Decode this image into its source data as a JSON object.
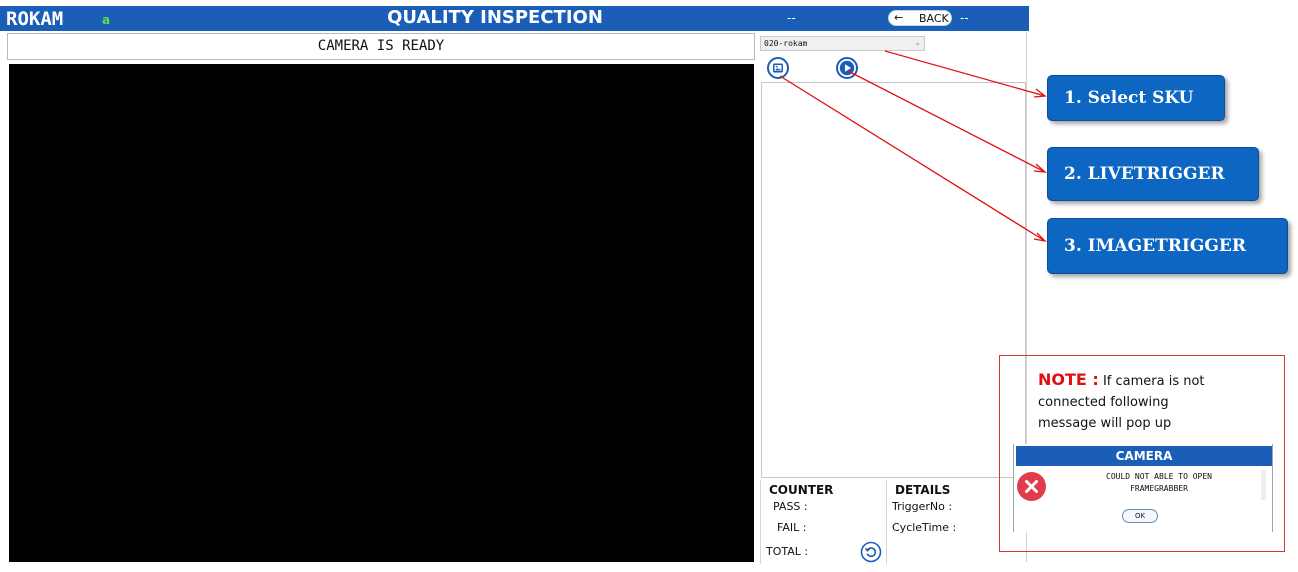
{
  "header": {
    "brand": "ROKAM",
    "brand_sub": "a",
    "title": "QUALITY INSPECTION",
    "status_left": "--",
    "back_label": "BACK",
    "back_icon": "arrow-left-icon",
    "status_right": "--"
  },
  "status_message": "CAMERA IS READY",
  "sku_select": {
    "value": "020-rokam",
    "icon": "chevron-down-icon"
  },
  "trigger_buttons": {
    "image_icon": "image-icon",
    "live_icon": "play-icon"
  },
  "counter": {
    "title": "COUNTER",
    "pass_label": "PASS :",
    "fail_label": "FAIL :",
    "total_label": "TOTAL :",
    "reset_icon": "reset-icon"
  },
  "details": {
    "title": "DETAILS",
    "trigger_label": "TriggerNo :",
    "cycle_label": "CycleTime :"
  },
  "callouts": [
    {
      "label": "1. Select  SKU"
    },
    {
      "label": "2. LIVETRIGGER"
    },
    {
      "label": "3. IMAGETRIGGER"
    }
  ],
  "note": {
    "label": "NOTE :",
    "line1": "If camera is not",
    "line2": "connected following",
    "line3": "message will pop up"
  },
  "popup": {
    "title": "CAMERA",
    "message_line1": "COULD NOT ABLE TO OPEN",
    "message_line2": "FRAMEGRABBER",
    "ok_label": "OK",
    "icon": "error-x-icon"
  },
  "colors": {
    "header_blue": "#1a5eb8",
    "callout_blue": "#0c66c2",
    "annotation_red": "#e01010",
    "error_red": "#e03c4c",
    "brand_sub_green": "#58e04a"
  }
}
